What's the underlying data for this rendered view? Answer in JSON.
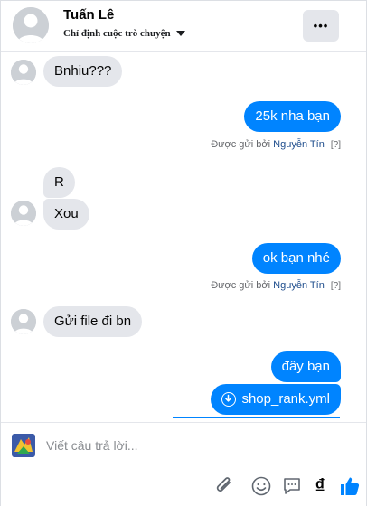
{
  "header": {
    "contact_name": "Tuấn Lê",
    "assign_label": "Chỉ định cuộc trò chuyện",
    "more_label": "•••"
  },
  "messages": [
    {
      "side": "in",
      "text": "Bnhiu???"
    },
    {
      "side": "out",
      "text": "25k nha bạn"
    },
    {
      "side": "in",
      "text": "R"
    },
    {
      "side": "in",
      "text": "Xou"
    },
    {
      "side": "out",
      "text": "ok bạn nhé"
    },
    {
      "side": "in",
      "text": "Gửi file đi bn"
    },
    {
      "side": "out",
      "text": "đây bạn"
    },
    {
      "side": "out",
      "text": "shop_rank.yml",
      "kind": "file"
    }
  ],
  "sent_by": {
    "prefix": "Được gửi bởi",
    "name": "Nguyễn Tín",
    "help": "[?]"
  },
  "composer": {
    "placeholder": "Viết câu trả lời...",
    "currency_symbol": "₫"
  },
  "colors": {
    "outgoing": "#0084ff",
    "incoming": "#e4e6eb",
    "link": "#1d4c8c"
  }
}
